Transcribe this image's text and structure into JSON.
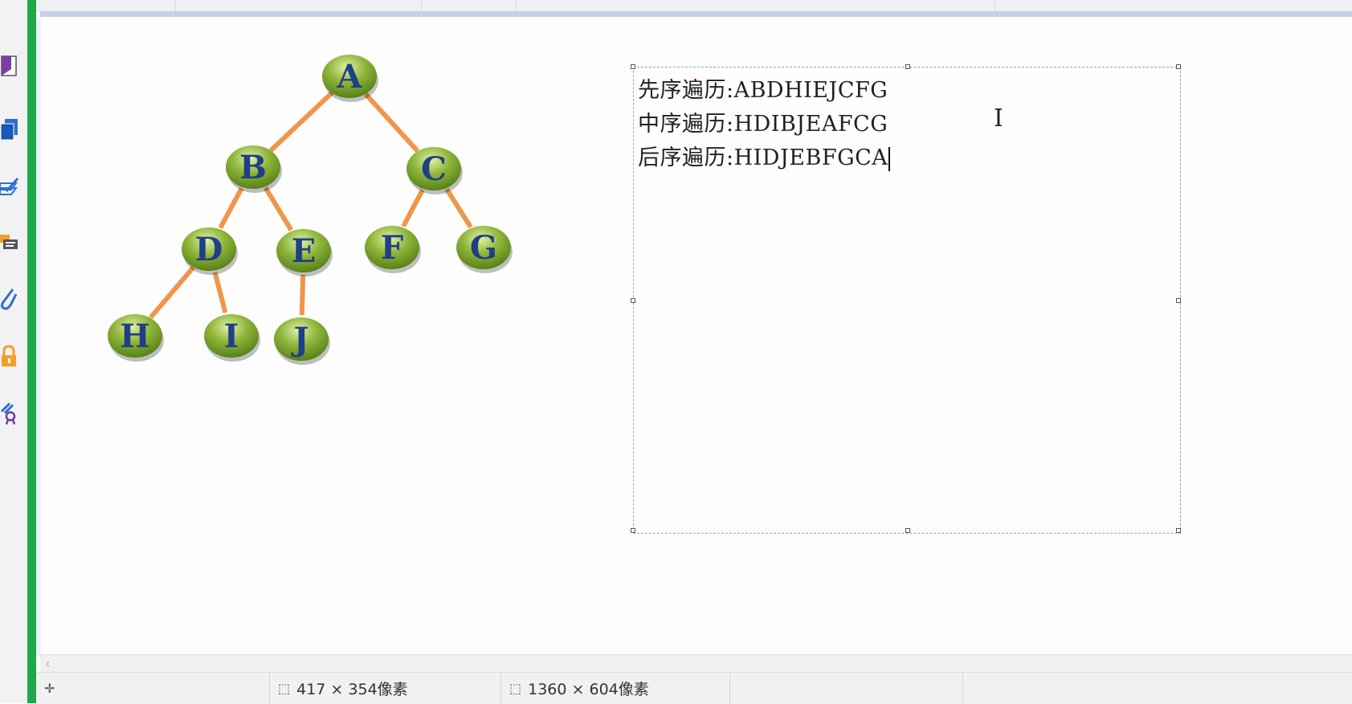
{
  "traversal": {
    "preorder": "先序遍历:ABDHIEJCFG",
    "inorder": "中序遍历:HDIBJEAFCG",
    "postorder": "后序遍历:HIDJEBFGCA"
  },
  "tree": {
    "nodes": [
      "A",
      "B",
      "C",
      "D",
      "E",
      "F",
      "G",
      "H",
      "I",
      "J"
    ],
    "edges": [
      [
        "A",
        "B"
      ],
      [
        "A",
        "C"
      ],
      [
        "B",
        "D"
      ],
      [
        "B",
        "E"
      ],
      [
        "C",
        "F"
      ],
      [
        "C",
        "G"
      ],
      [
        "D",
        "H"
      ],
      [
        "D",
        "I"
      ],
      [
        "E",
        "J"
      ]
    ],
    "node_color": "#8fb63b",
    "edge_color": "#f0954a",
    "label_color": "#1f3f86"
  },
  "status": {
    "selection_size": "417 × 354像素",
    "image_size": "1360 × 604像素"
  },
  "icons": {
    "move": "move-cross-icon",
    "selection": "selection-size-icon",
    "image": "image-size-icon"
  },
  "colors": {
    "green_bar": "#1da84a",
    "textbox_border": "#6aaee0"
  }
}
